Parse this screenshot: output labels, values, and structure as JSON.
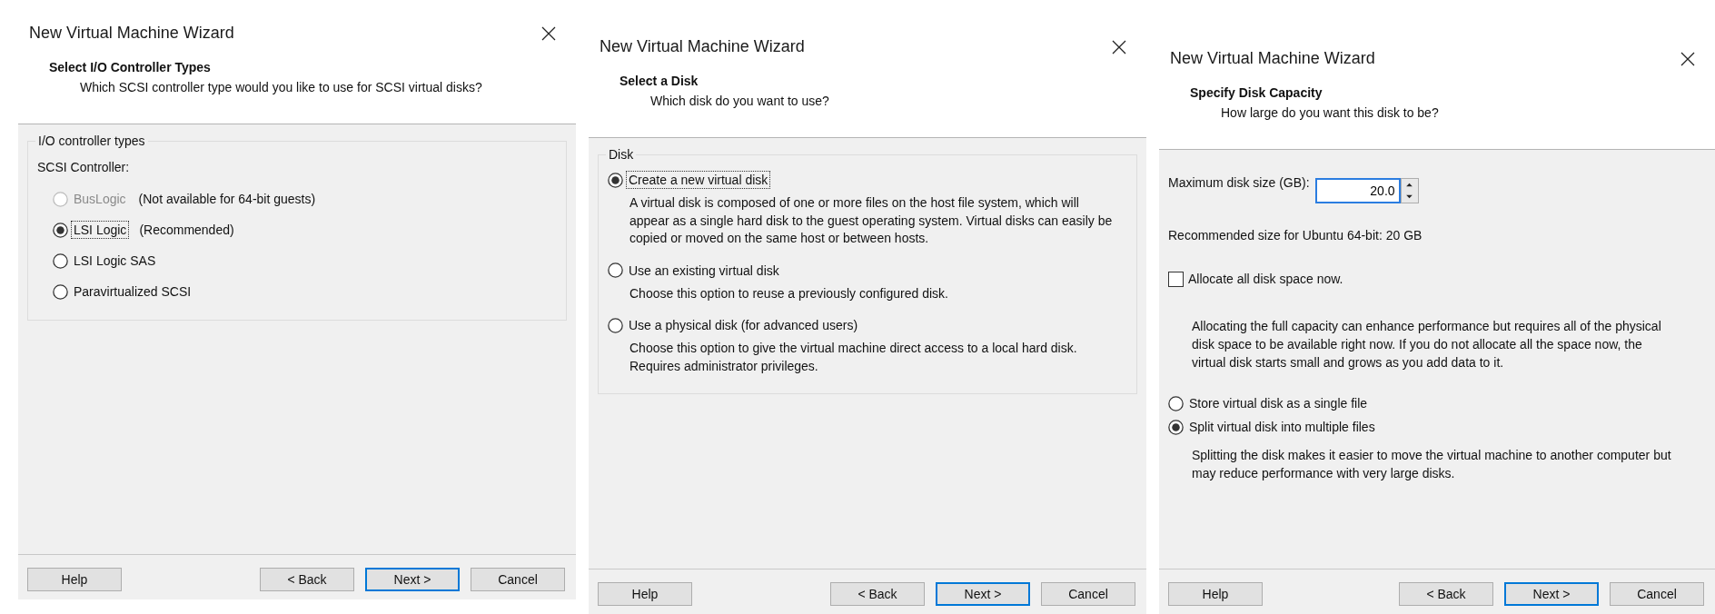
{
  "dialogs": [
    {
      "title": "New Virtual Machine Wizard",
      "heading": "Select I/O Controller Types",
      "subheading": "Which SCSI controller type would you like to use for SCSI virtual disks?",
      "content": [
        {
          "kind": "group",
          "legend": "I/O controller types",
          "items": [
            {
              "kind": "label",
              "text": "SCSI Controller:"
            },
            {
              "kind": "radio",
              "label": "BusLogic",
              "note": "(Not available for 64-bit guests)",
              "selected": false,
              "disabled": true,
              "focused": false
            },
            {
              "kind": "radio",
              "label": "LSI Logic",
              "note": "(Recommended)",
              "selected": true,
              "disabled": false,
              "focused": true
            },
            {
              "kind": "radio",
              "label": "LSI Logic SAS",
              "selected": false,
              "disabled": false,
              "focused": false
            },
            {
              "kind": "radio",
              "label": "Paravirtualized SCSI",
              "selected": false,
              "disabled": false,
              "focused": false
            }
          ]
        }
      ],
      "buttons": [
        {
          "label": "Help",
          "default": false
        },
        {
          "label": "< Back",
          "default": false
        },
        {
          "label": "Next >",
          "default": true
        },
        {
          "label": "Cancel",
          "default": false
        }
      ]
    },
    {
      "title": "New Virtual Machine Wizard",
      "heading": "Select a Disk",
      "subheading": "Which disk do you want to use?",
      "content": [
        {
          "kind": "group",
          "legend": "Disk",
          "items": [
            {
              "kind": "radio",
              "label": "Create a new virtual disk",
              "selected": true,
              "disabled": false,
              "focused": true
            },
            {
              "kind": "description",
              "text": "A virtual disk is composed of one or more files on the host file system, which will appear as a single hard disk to the guest operating system. Virtual disks can easily be copied or moved on the same host or between hosts."
            },
            {
              "kind": "radio",
              "label": "Use an existing virtual disk",
              "selected": false,
              "disabled": false,
              "focused": false
            },
            {
              "kind": "description",
              "text": "Choose this option to reuse a previously configured disk."
            },
            {
              "kind": "radio",
              "label": "Use a physical disk (for advanced users)",
              "selected": false,
              "disabled": false,
              "focused": false
            },
            {
              "kind": "description",
              "text": "Choose this option to give the virtual machine direct access to a local hard disk. Requires administrator privileges."
            }
          ]
        }
      ],
      "buttons": [
        {
          "label": "Help",
          "default": false
        },
        {
          "label": "< Back",
          "default": false
        },
        {
          "label": "Next >",
          "default": true
        },
        {
          "label": "Cancel",
          "default": false
        }
      ]
    },
    {
      "title": "New Virtual Machine Wizard",
      "heading": "Specify Disk Capacity",
      "subheading": "How large do you want this disk to be?",
      "content": [
        {
          "kind": "spin",
          "label": "Maximum disk size (GB):",
          "value": "20.0",
          "focused": true
        },
        {
          "kind": "label",
          "text": "Recommended size for Ubuntu 64-bit: 20 GB"
        },
        {
          "kind": "checkbox",
          "label": "Allocate all disk space now.",
          "checked": false
        },
        {
          "kind": "description",
          "text": "Allocating the full capacity can enhance performance but requires all of the physical disk space to be available right now. If you do not allocate all the space now, the virtual disk starts small and grows as you add data to it."
        },
        {
          "kind": "radio",
          "label": "Store virtual disk as a single file",
          "selected": false,
          "disabled": false,
          "focused": false
        },
        {
          "kind": "radio",
          "label": "Split virtual disk into multiple files",
          "selected": true,
          "disabled": false,
          "focused": false
        },
        {
          "kind": "description",
          "text": "Splitting the disk makes it easier to move the virtual machine to another computer but may reduce performance with very large disks."
        }
      ],
      "buttons": [
        {
          "label": "Help",
          "default": false
        },
        {
          "label": "< Back",
          "default": false
        },
        {
          "label": "Next >",
          "default": true
        },
        {
          "label": "Cancel",
          "default": false
        }
      ]
    }
  ]
}
